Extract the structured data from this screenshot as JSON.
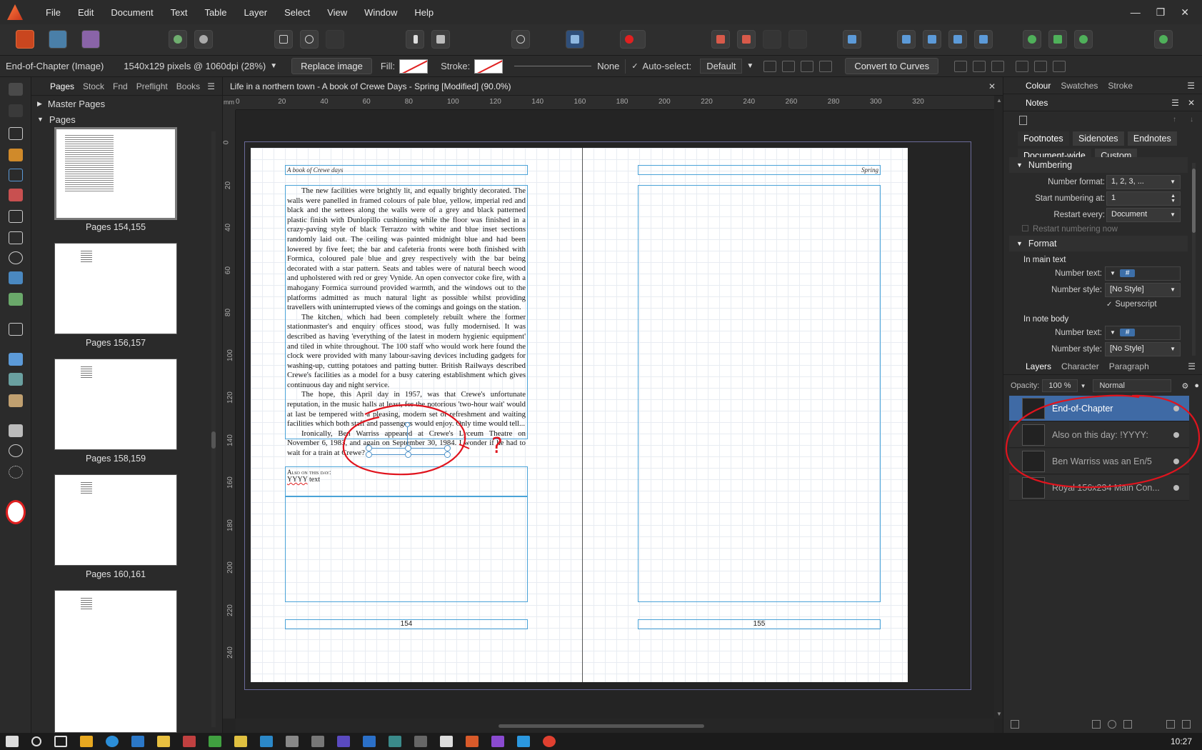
{
  "menubar": {
    "items": [
      "File",
      "Edit",
      "Document",
      "Text",
      "Table",
      "Layer",
      "Select",
      "View",
      "Window",
      "Help"
    ]
  },
  "context": {
    "selection": "End-of-Chapter (Image)",
    "dimensions": "1540x129 pixels @ 1060dpi (28%)",
    "replace_image": "Replace image",
    "fill_label": "Fill:",
    "stroke_label": "Stroke:",
    "stroke_none": "None",
    "auto_select_label": "Auto-select:",
    "auto_select_value": "Default",
    "convert_to_curves": "Convert to Curves"
  },
  "left_panel": {
    "tabs": [
      "Pages",
      "Stock",
      "Fnd",
      "Preflight",
      "Books"
    ],
    "master_pages": "Master Pages",
    "pages": "Pages",
    "spreads": [
      "Pages 154,155",
      "Pages 156,157",
      "Pages 158,159",
      "Pages 160,161"
    ]
  },
  "document": {
    "title": "Life in a northern town - A book of Crewe Days - Spring [Modified] (90.0%)",
    "ruler_unit": "mm",
    "ruler_h": [
      "0",
      "20",
      "40",
      "60",
      "80",
      "100",
      "120",
      "140",
      "160",
      "180",
      "200",
      "220",
      "240",
      "260",
      "280",
      "300",
      "320"
    ],
    "ruler_v": [
      "0",
      "20",
      "40",
      "60",
      "80",
      "100",
      "120",
      "140",
      "160",
      "180",
      "200",
      "220",
      "240"
    ],
    "left_header": "A book of Crewe days",
    "right_header": "Spring",
    "paragraphs": [
      "The new facilities were brightly lit, and equally brightly decorated. The walls were panelled in framed colours of pale blue, yellow, imperial red and black and the settees along the walls were of a grey and black patterned plastic finish with Dunlopillo cushioning while the floor was finished in a crazy-paving style of black Terrazzo with white and blue inset sections randomly laid out. The ceiling was painted midnight blue and had been lowered by five feet; the bar and cafeteria fronts were both finished with Formica, coloured pale blue and grey respectively with the bar being decorated with a star pattern. Seats and tables were of natural beech wood and upholstered with red or grey Vynide. An open convector coke fire, with a mahogany Formica surround provided warmth, and the windows out to the platforms admitted as much natural light as possible whilst providing travellers with uninterrupted views of the comings and goings on the station.",
      "The kitchen, which had been completely rebuilt where the former stationmaster's and enquiry offices stood, was fully modernised. It was described as having 'everything of the latest in modern hygienic equipment' and tiled in white throughout. The 100 staff who would work here found the clock were provided with many labour-saving devices including gadgets for washing-up, cutting potatoes and patting butter. British Railways described Crewe's facilities as a model for a busy catering establishment which gives continuous day and night service.",
      "The hope, this April day in 1957, was that Crewe's unfortunate reputation, in the music halls at least, for the notorious 'two-hour wait' would at last be tempered with a pleasing, modern set of refreshment and waiting facilities which both staff and passengers would enjoy. Only time would tell...",
      "Ironically, Ben Warriss appeared at Crewe's Lyceum Theatre on November 6, 1983, and again on September 30, 1984. I wonder if he had to wait for a train at Crewe?"
    ],
    "also_label": "Also on this day:",
    "also_var": "YYYY",
    "also_text": "text",
    "left_folio": "154",
    "right_folio": "155"
  },
  "right_panel": {
    "top_tabs": [
      "Colour",
      "Swatches",
      "Stroke"
    ],
    "notes_tab": "Notes",
    "note_types": [
      "Footnotes",
      "Sidenotes",
      "Endnotes"
    ],
    "scopes": [
      "Document-wide",
      "Custom"
    ],
    "numbering": "Numbering",
    "number_format_label": "Number format:",
    "number_format": "1, 2, 3, ...",
    "start_label": "Start numbering at:",
    "start_value": "1",
    "restart_label": "Restart every:",
    "restart_value": "Document",
    "restart_now": "Restart numbering now",
    "format": "Format",
    "in_main": "In main text",
    "number_text_label": "Number text:",
    "number_text_token": "#",
    "number_style_label": "Number style:",
    "number_style": "[No Style]",
    "superscript": "Superscript",
    "in_note": "In note body",
    "layers_tabs": [
      "Layers",
      "Character",
      "Paragraph"
    ],
    "opacity_label": "Opacity:",
    "opacity": "100 %",
    "blend": "Normal",
    "layers": [
      "End-of-Chapter",
      "Also on this day: !YYYY:",
      "Ben Warriss was an En/5",
      "Royal 156x234 Main Con..."
    ]
  },
  "annotation": {
    "mark": "?",
    "color": "#e0141e"
  },
  "taskbar": {
    "clock": "10:27"
  }
}
